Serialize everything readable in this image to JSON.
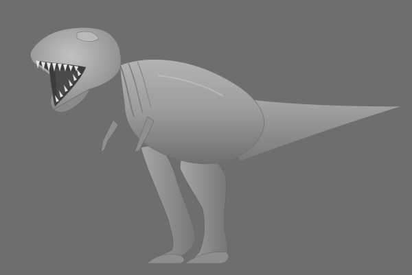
{
  "viewport": {
    "background_color": "#6e6e6e",
    "model": {
      "icon": "t-rex-model-icon",
      "shading": "smooth-gray",
      "base_color": "#9a9a9a",
      "shadow_color": "#5a5a5a",
      "highlight_color": "#c4c4c4",
      "teeth_color": "#e6e6e6",
      "mouth_color": "#3a3a3a"
    }
  }
}
